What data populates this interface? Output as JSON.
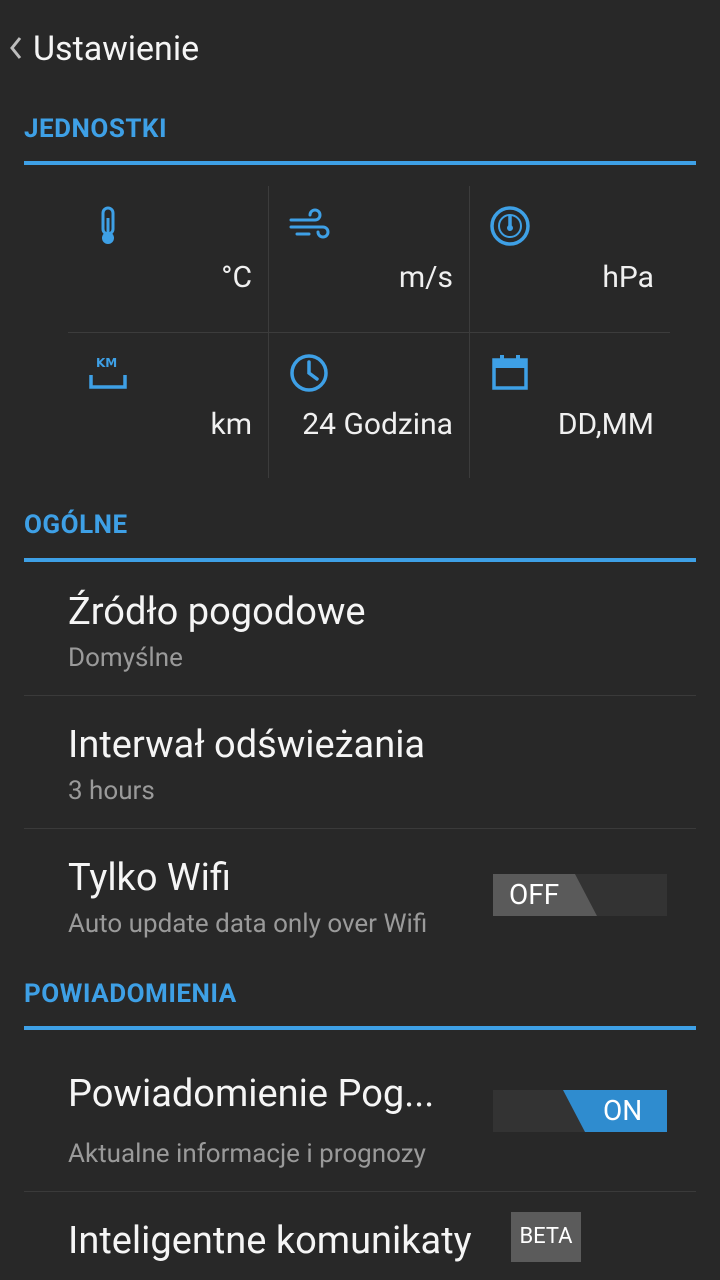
{
  "header": {
    "title": "Ustawienie"
  },
  "sections": {
    "units": {
      "title": "JEDNOSTKI"
    },
    "general": {
      "title": "OGÓLNE"
    },
    "notifications": {
      "title": "POWIADOMIENIA"
    }
  },
  "units": [
    {
      "icon": "thermometer-icon",
      "value": "°C"
    },
    {
      "icon": "wind-icon",
      "value": "m/s"
    },
    {
      "icon": "gauge-icon",
      "value": "hPa"
    },
    {
      "icon": "distance-km-icon",
      "value": "km"
    },
    {
      "icon": "clock-icon",
      "value": "24 Godzina"
    },
    {
      "icon": "calendar-icon",
      "value": "DD,MM"
    }
  ],
  "general": {
    "source": {
      "title": "Źródło pogodowe",
      "subtitle": "Domyślne"
    },
    "interval": {
      "title": "Interwał odświeżania",
      "subtitle": "3 hours"
    },
    "wifi": {
      "title": "Tylko Wifi",
      "subtitle": "Auto update data only over Wifi",
      "toggle": "OFF"
    }
  },
  "notifications": {
    "weather": {
      "title": "Powiadomienie Pog...",
      "subtitle": "Aktualne informacje i prognozy",
      "toggle": "ON"
    },
    "smart": {
      "title": "Inteligentne komunikaty",
      "badge": "BETA"
    }
  },
  "colors": {
    "accent": "#3ea0e6",
    "background": "#282828",
    "toggle_on": "#2f8ccf"
  }
}
